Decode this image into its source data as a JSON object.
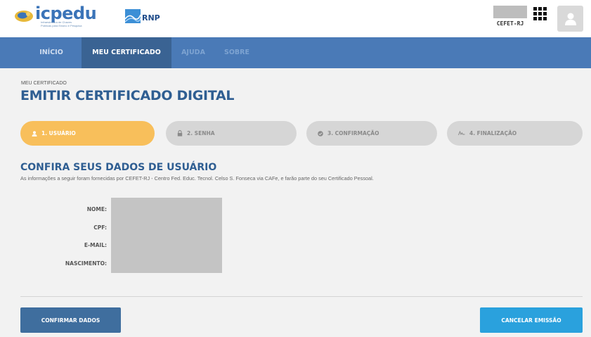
{
  "header": {
    "logo_name": "icpedu",
    "logo_tagline": "Infraestrutura de Chaves Públicas para Ensino e Pesquisa",
    "partner_logo": "RNP",
    "institution": "CEFET-RJ",
    "apps_icon": "apps-grid-icon",
    "avatar_icon": "user-icon"
  },
  "nav": {
    "items": [
      {
        "label": "INÍCIO"
      },
      {
        "label": "MEU CERTIFICADO"
      },
      {
        "label": "AJUDA"
      },
      {
        "label": "SOBRE"
      }
    ]
  },
  "page": {
    "breadcrumb": "MEU CERTIFICADO",
    "title": "EMITIR CERTIFICADO DIGITAL"
  },
  "steps": [
    {
      "label": "1. USUÁRIO",
      "icon": "user-icon",
      "state": "active"
    },
    {
      "label": "2. SENHA",
      "icon": "lock-icon",
      "state": "inactive"
    },
    {
      "label": "3. CONFIRMAÇÃO",
      "icon": "check-circle-icon",
      "state": "inactive"
    },
    {
      "label": "4. FINALIZAÇÃO",
      "icon": "signature-icon",
      "state": "inactive"
    }
  ],
  "section": {
    "title": "CONFIRA SEUS DADOS DE USUÁRIO",
    "description": "As informações a seguir foram fornecidas por CEFET-RJ - Centro Fed. Educ. Tecnol. Celso S. Fonseca via CAFe, e farão parte do seu Certificado Pessoal."
  },
  "fields": {
    "name_label": "NOME:",
    "cpf_label": "CPF:",
    "email_label": "E-MAIL:",
    "birth_label": "NASCIMENTO:"
  },
  "actions": {
    "confirm_label": "CONFIRMAR DADOS",
    "cancel_label": "CANCELAR EMISSÃO"
  },
  "colors": {
    "nav_bg": "#4a7ab7",
    "nav_active": "#3a6393",
    "step_active": "#f8bf5b",
    "title_blue": "#2f5e92",
    "confirm_btn": "#3f6e9e",
    "cancel_btn": "#2aa1dd"
  }
}
